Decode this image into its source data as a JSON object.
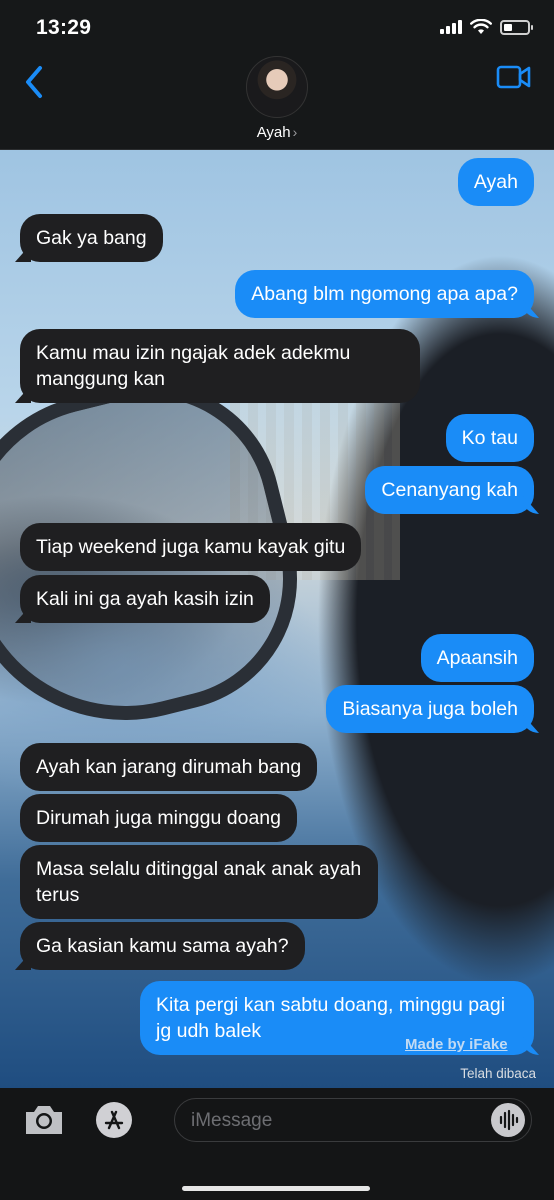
{
  "status": {
    "time": "13:29",
    "battery_percent": 35
  },
  "header": {
    "contact_name": "Ayah",
    "chevron": "›"
  },
  "messages": [
    {
      "side": "out",
      "text": "Ayah"
    },
    {
      "side": "in",
      "text": "Gak ya bang"
    },
    {
      "side": "out",
      "text": "Abang blm ngomong apa apa?"
    },
    {
      "side": "in",
      "text": "Kamu mau izin ngajak adek adekmu manggung kan"
    },
    {
      "side": "out",
      "text": "Ko tau"
    },
    {
      "side": "out",
      "text": "Cenanyang kah"
    },
    {
      "side": "in",
      "text": "Tiap weekend juga kamu kayak gitu"
    },
    {
      "side": "in",
      "text": "Kali ini ga ayah kasih izin"
    },
    {
      "side": "out",
      "text": "Apaansih"
    },
    {
      "side": "out",
      "text": "Biasanya juga boleh"
    },
    {
      "side": "in",
      "text": "Ayah kan jarang dirumah bang"
    },
    {
      "side": "in",
      "text": "Dirumah juga minggu doang"
    },
    {
      "side": "in",
      "text": "Masa selalu ditinggal anak anak ayah terus"
    },
    {
      "side": "in",
      "text": "Ga kasian kamu sama ayah?"
    },
    {
      "side": "out",
      "text": "Kita pergi kan sabtu doang, minggu pagi jg udh balek"
    }
  ],
  "watermark": "Made by iFake",
  "read_receipt": "Telah dibaca",
  "input": {
    "placeholder": "iMessage"
  },
  "colors": {
    "outgoing": "#1a8cf7",
    "incoming": "#1f1f21",
    "accent": "#1a8cf7"
  },
  "icons": [
    "back-chevron-icon",
    "video-camera-icon",
    "camera-icon",
    "app-store-icon",
    "audio-waveform-icon",
    "wifi-icon",
    "signal-icon",
    "battery-icon"
  ]
}
